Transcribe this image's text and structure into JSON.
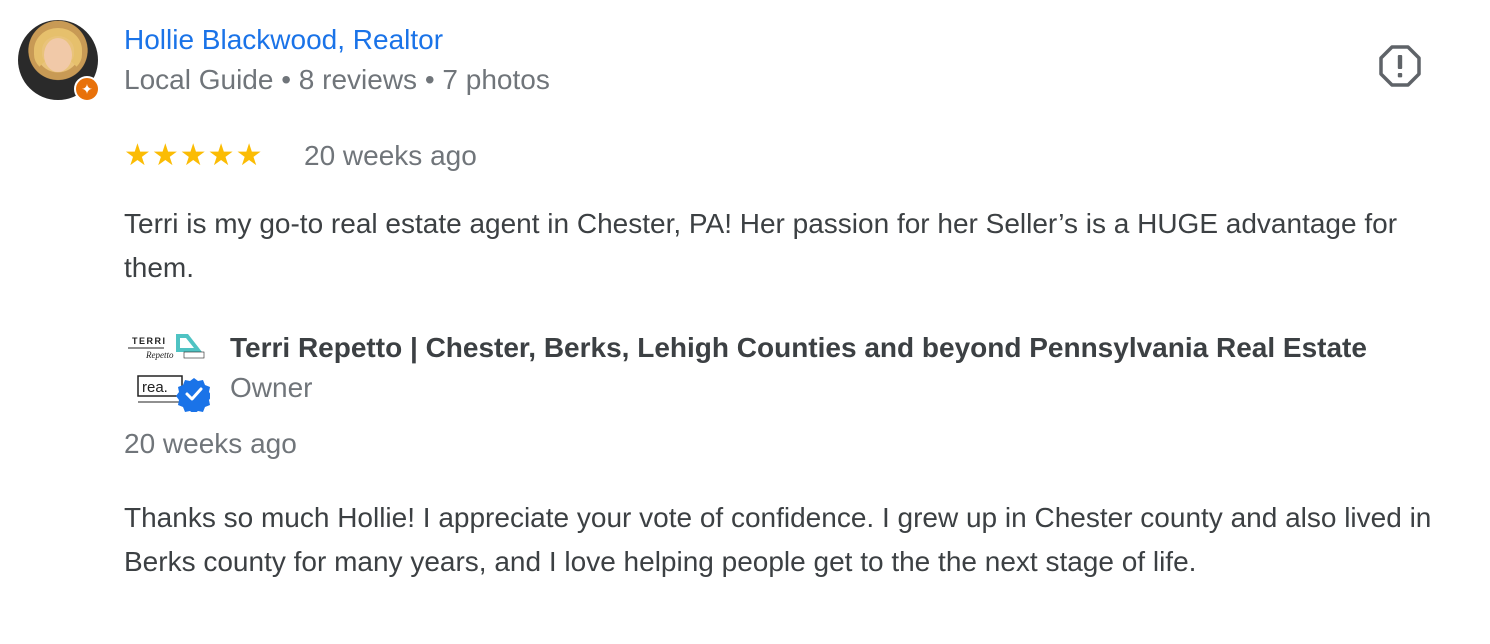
{
  "review": {
    "reviewer_name": "Hollie Blackwood, Realtor",
    "reviewer_meta": "Local Guide • 8 reviews • 7 photos",
    "rating": 5,
    "stars": "★★★★★",
    "time": "20 weeks ago",
    "text": "Terri is my go-to real estate agent in Chester, PA! Her passion for her Seller’s is a HUGE advantage for them."
  },
  "reply": {
    "owner_name": "Terri Repetto | Chester, Berks, Lehigh Counties and beyond Pennsylvania Real Estate",
    "owner_role": "Owner",
    "time": "20 weeks ago",
    "text": "Thanks so much Hollie! I appreciate your vote of confidence. I grew up in Chester county and also lived in Berks county for many years, and I love helping people get to the the next stage of life."
  },
  "logo_text": {
    "line1": "TERRI",
    "line2": "Repetto",
    "line3": "rea."
  },
  "icons": {
    "report": "report-icon",
    "guide_badge": "local-guide-badge-icon",
    "verified": "verified-check-icon"
  },
  "colors": {
    "name_link": "#1a73e8",
    "star": "#fbbc04",
    "guide_badge": "#e8710a",
    "verified": "#1a73e8",
    "muted_text": "#70757a",
    "body_text": "#3c4043"
  }
}
